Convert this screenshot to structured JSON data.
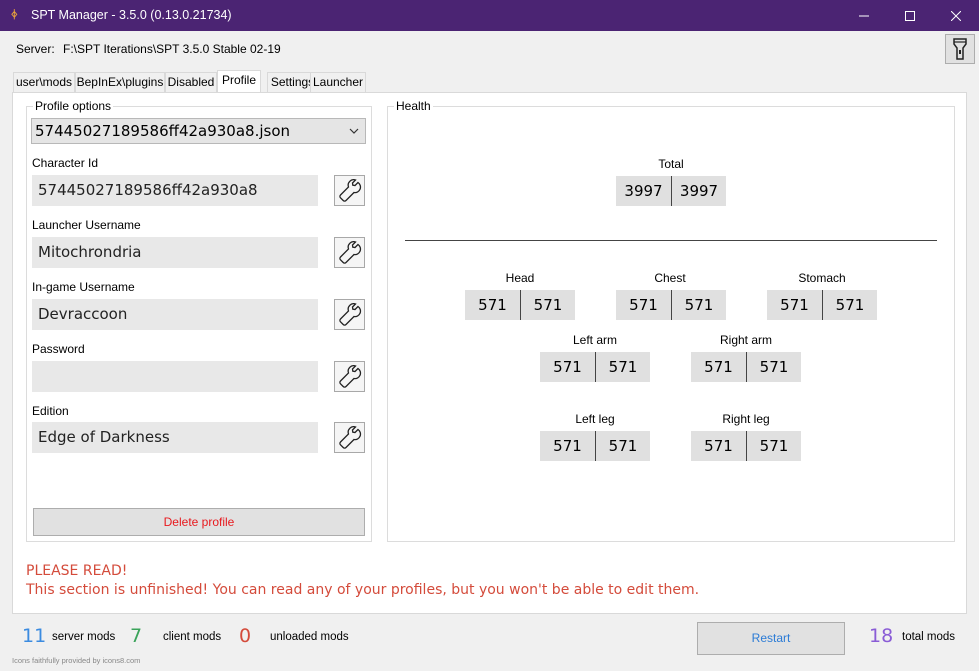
{
  "window": {
    "title": "SPT Manager - 3.5.0 (0.13.0.21734)",
    "app_icon": "spt-logo-icon"
  },
  "server": {
    "label": "Server:",
    "path": "F:\\SPT Iterations\\SPT 3.5.0 Stable 02-19",
    "action_icon": "flashlight-icon"
  },
  "tabs": [
    "user\\mods",
    "BepInEx\\plugins",
    "Disabled",
    "Profile",
    "Settings",
    "Launcher"
  ],
  "active_tab": "Profile",
  "profile": {
    "group_label": "Profile options",
    "selected_file": "57445027189586ff42a930a8.json",
    "fields": [
      {
        "label": "Character Id",
        "value": "57445027189586ff42a930a8"
      },
      {
        "label": "Launcher Username",
        "value": "Mitochrondria"
      },
      {
        "label": "In-game Username",
        "value": "Devraccoon"
      },
      {
        "label": "Password",
        "value": ""
      },
      {
        "label": "Edition",
        "value": "Edge of Darkness"
      }
    ],
    "delete_label": "Delete profile"
  },
  "health": {
    "group_label": "Health",
    "total": {
      "label": "Total",
      "current": "3997",
      "max": "3997"
    },
    "parts": {
      "head": {
        "label": "Head",
        "current": "571",
        "max": "571"
      },
      "chest": {
        "label": "Chest",
        "current": "571",
        "max": "571"
      },
      "stomach": {
        "label": "Stomach",
        "current": "571",
        "max": "571"
      },
      "left_arm": {
        "label": "Left arm",
        "current": "571",
        "max": "571"
      },
      "right_arm": {
        "label": "Right arm",
        "current": "571",
        "max": "571"
      },
      "left_leg": {
        "label": "Left leg",
        "current": "571",
        "max": "571"
      },
      "right_leg": {
        "label": "Right leg",
        "current": "571",
        "max": "571"
      }
    }
  },
  "warning": {
    "title": "PLEASE READ!",
    "body": "This section is unfinished! You can read any of your profiles, but you won't be able to edit them."
  },
  "status": {
    "server_mods": {
      "count": "11",
      "label": "server mods",
      "color": "#3b8be0"
    },
    "client_mods": {
      "count": "7",
      "label": "client mods",
      "color": "#3aa35a"
    },
    "unloaded_mods": {
      "count": "0",
      "label": "unloaded mods",
      "color": "#d44b3b"
    },
    "restart_label": "Restart",
    "total_mods": {
      "count": "18",
      "label": "total mods",
      "color": "#8a5cd6"
    },
    "credit": "Icons faithfully provided by icons8.com"
  }
}
